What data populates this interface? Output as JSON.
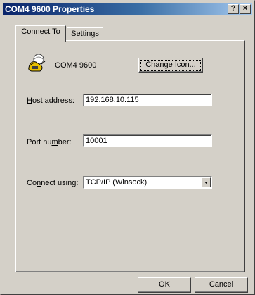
{
  "window": {
    "title": "COM4 9600 Properties",
    "help_button": "?",
    "close_button": "×"
  },
  "tabs": [
    {
      "label": "Connect To",
      "active": true
    },
    {
      "label": "Settings",
      "active": false
    }
  ],
  "connection": {
    "name": "COM4 9600",
    "change_icon_label": {
      "pre": "Change ",
      "key": "I",
      "post": "con..."
    }
  },
  "host": {
    "label": {
      "pre": "",
      "key": "H",
      "post": "ost address:"
    },
    "value": "192.168.10.115"
  },
  "port": {
    "label": {
      "pre": "Port nu",
      "key": "m",
      "post": "ber:"
    },
    "value": "10001"
  },
  "connect_using": {
    "label": {
      "pre": "Co",
      "key": "n",
      "post": "nect using:"
    },
    "value": "TCP/IP (Winsock)"
  },
  "footer": {
    "ok_label": "OK",
    "cancel_label": "Cancel"
  },
  "colors": {
    "face": "#d4d0c8",
    "title_start": "#0a246a",
    "title_end": "#a6caf0"
  },
  "icons": {
    "connection_icon": "phone-globe-icon",
    "dropdown_icon": "chevron-down-icon"
  }
}
